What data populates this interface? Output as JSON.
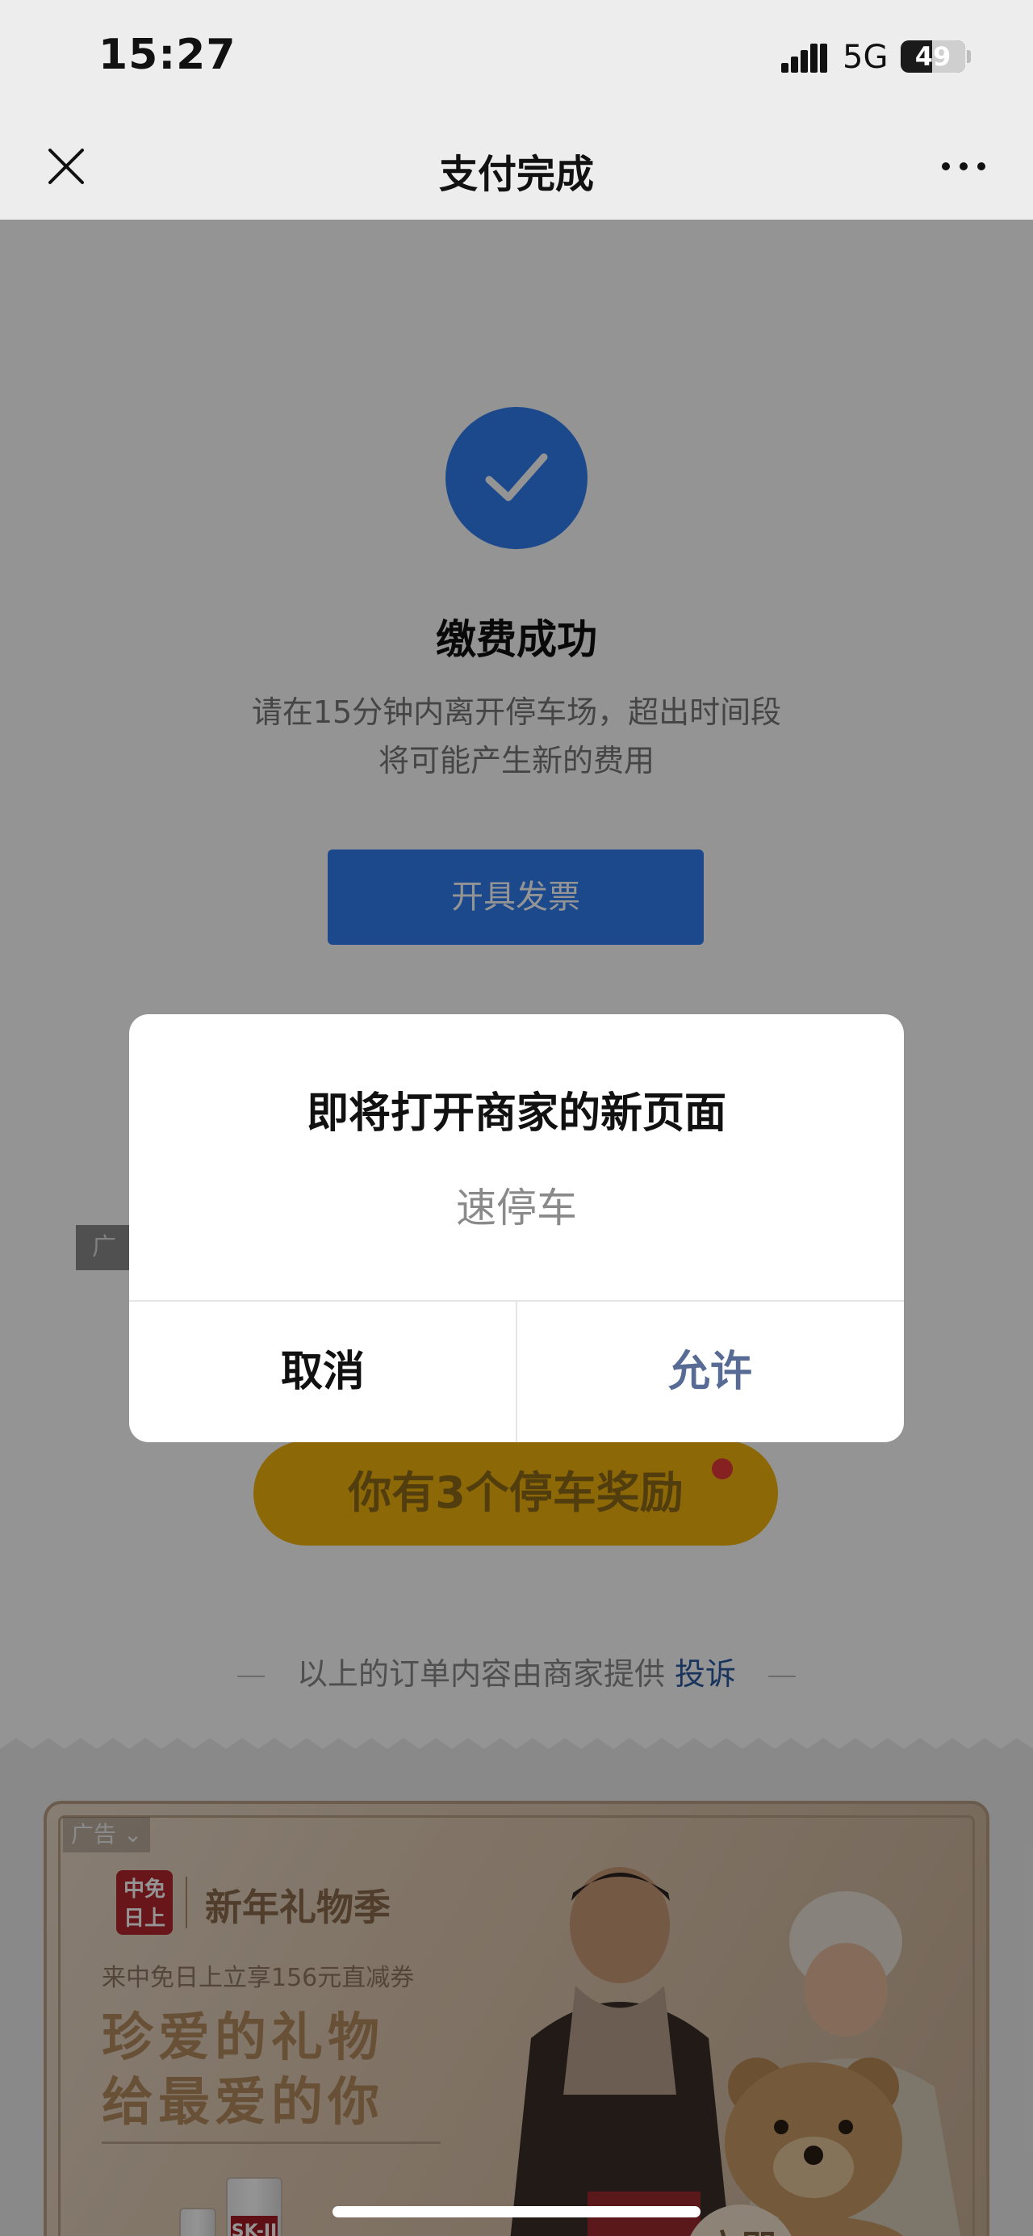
{
  "status_bar": {
    "time": "15:27",
    "network": "5G",
    "battery": "49",
    "battery_level": 0.49
  },
  "nav": {
    "title": "支付完成"
  },
  "payment": {
    "success_title": "缴费成功",
    "notice_line1": "请在15分钟内离开停车场，超出时间段",
    "notice_line2": "将可能产生新的费用",
    "invoice_button": "开具发票"
  },
  "ad_small_label": "广告",
  "reward_button": "你有3个停车奖励",
  "footer": {
    "text": "以上的订单内容由商家提供",
    "complaint_link": "投诉"
  },
  "banner": {
    "ad_label": "广告",
    "brand_logo": "中免日上",
    "season_title": "新年礼物季",
    "promo": "来中免日上立享156元直减券",
    "headline1": "珍爱的礼物",
    "headline2": "给最爱的你",
    "product_label": "SK-II",
    "cta": "立即"
  },
  "dialog": {
    "title": "即将打开商家的新页面",
    "merchant": "速停车",
    "cancel": "取消",
    "allow": "允许"
  },
  "colors": {
    "primary": "#2f7ff2",
    "link": "#576b95",
    "reward": "#f2b40b"
  }
}
